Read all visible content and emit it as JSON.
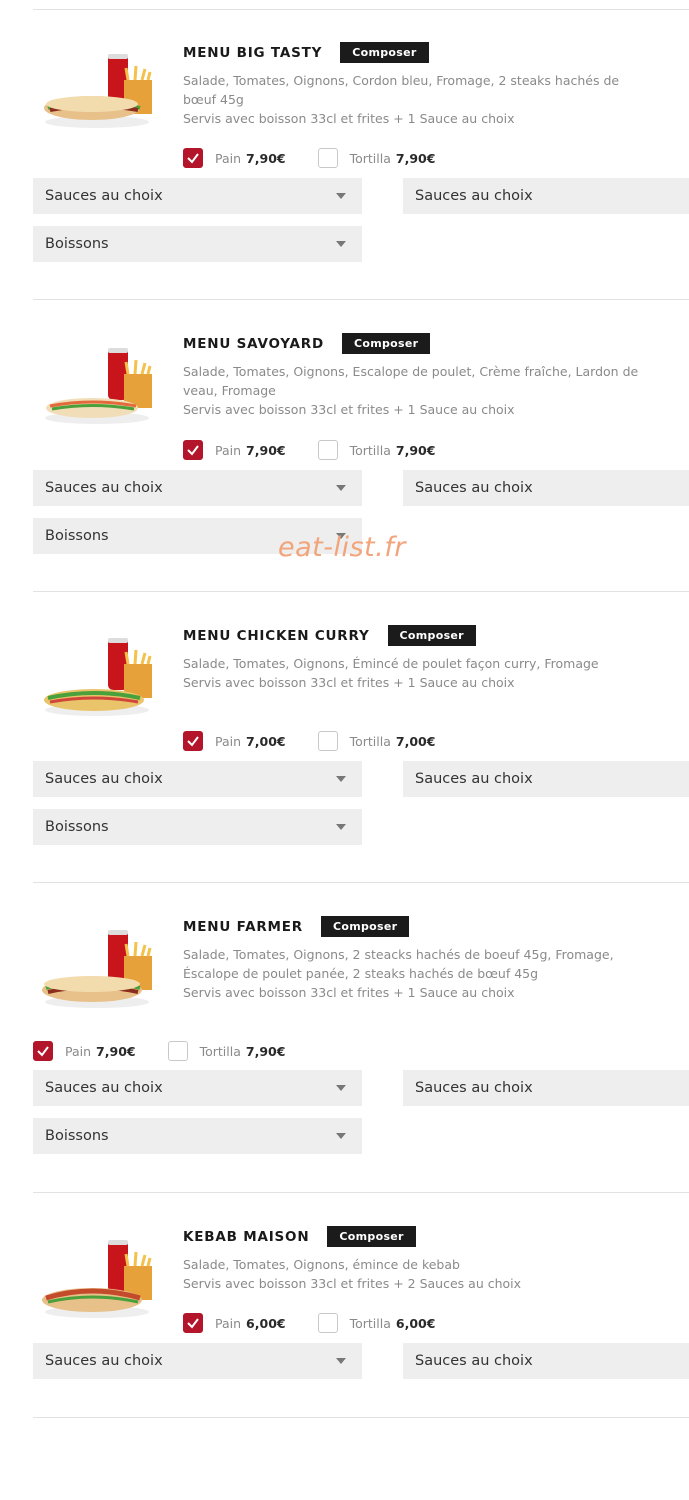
{
  "watermark": "eat-list.fr",
  "menus": [
    {
      "title": "MENU BIG TASTY",
      "composer_label": "Composer",
      "description": "Salade, Tomates, Oignons, Cordon bleu, Fromage, 2 steaks hachés de bœuf 45g",
      "served": "Servis avec boisson 33cl et frites + 1 Sauce au choix",
      "options": [
        {
          "label": "Pain",
          "price": "7,90€",
          "checked": true
        },
        {
          "label": "Tortilla",
          "price": "7,90€",
          "checked": false
        }
      ],
      "sauce_left": "Sauces au choix",
      "sauce_right": "Sauces au choix",
      "drinks": "Boissons"
    },
    {
      "title": "MENU SAVOYARD",
      "composer_label": "Composer",
      "description": "Salade, Tomates, Oignons, Escalope de poulet, Crème fraîche, Lardon de veau, Fromage",
      "served": "Servis avec boisson 33cl et frites + 1 Sauce au choix",
      "options": [
        {
          "label": "Pain",
          "price": "7,90€",
          "checked": true
        },
        {
          "label": "Tortilla",
          "price": "7,90€",
          "checked": false
        }
      ],
      "sauce_left": "Sauces au choix",
      "sauce_right": "Sauces au choix",
      "drinks": "Boissons"
    },
    {
      "title": "MENU CHICKEN CURRY",
      "composer_label": "Composer",
      "description": "Salade, Tomates, Oignons, Émincé de poulet façon curry, Fromage",
      "served": "Servis avec boisson 33cl et frites + 1 Sauce au choix",
      "options": [
        {
          "label": "Pain",
          "price": "7,00€",
          "checked": true
        },
        {
          "label": "Tortilla",
          "price": "7,00€",
          "checked": false
        }
      ],
      "sauce_left": "Sauces au choix",
      "sauce_right": "Sauces au choix",
      "drinks": "Boissons"
    },
    {
      "title": "MENU FARMER",
      "composer_label": "Composer",
      "description": "Salade, Tomates, Oignons, 2 steacks hachés de boeuf 45g, Fromage, Éscalope de poulet panée, 2 steaks hachés de bœuf 45g",
      "served": "Servis avec boisson 33cl et frites + 1 Sauce au choix",
      "options": [
        {
          "label": "Pain",
          "price": "7,90€",
          "checked": true
        },
        {
          "label": "Tortilla",
          "price": "7,90€",
          "checked": false
        }
      ],
      "sauce_left": "Sauces au choix",
      "sauce_right": "Sauces au choix",
      "drinks": "Boissons"
    },
    {
      "title": "KEBAB MAISON",
      "composer_label": "Composer",
      "description": "Salade, Tomates, Oignons, émince de kebab",
      "served": "Servis avec boisson 33cl et frites + 2 Sauces au choix",
      "options": [
        {
          "label": "Pain",
          "price": "6,00€",
          "checked": true
        },
        {
          "label": "Tortilla",
          "price": "6,00€",
          "checked": false
        }
      ],
      "sauce_left": "Sauces au choix",
      "sauce_right": "Sauces au choix"
    }
  ]
}
